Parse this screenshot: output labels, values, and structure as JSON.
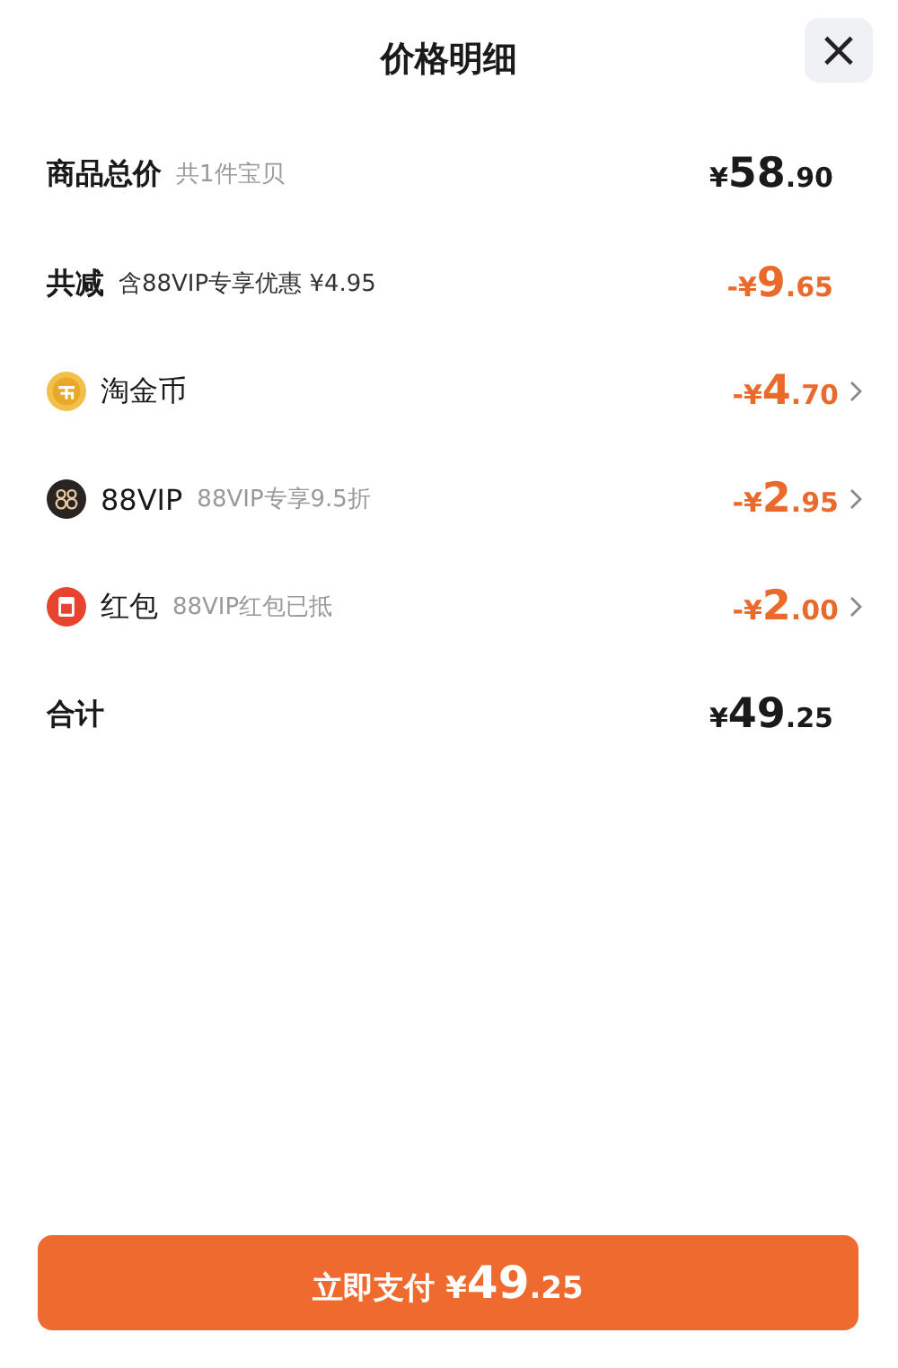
{
  "header": {
    "title": "价格明细",
    "close": "×"
  },
  "rows": [
    {
      "kind": "subtotal",
      "label": "商品总价",
      "note": "共1件宝贝",
      "amount": {
        "prefix": "¥",
        "main": "58",
        "fraction": ".90"
      },
      "link": false
    },
    {
      "kind": "discount_total",
      "label": "共减",
      "note": "含88VIP专享优惠 ¥4.95",
      "amount": {
        "prefix": "-¥",
        "main": "9",
        "fraction": ".65"
      },
      "link": false
    },
    {
      "kind": "coin",
      "label": "淘金币",
      "amount": {
        "prefix": "-¥",
        "main": "4",
        "fraction": ".70"
      },
      "link": true
    },
    {
      "kind": "vip",
      "label": "88VIP",
      "note": "88VIP专享9.5折",
      "amount": {
        "prefix": "-¥",
        "main": "2",
        "fraction": ".95"
      },
      "link": true
    },
    {
      "kind": "packet",
      "label": "红包",
      "note": "88VIP红包已抵",
      "amount": {
        "prefix": "-¥",
        "main": "2",
        "fraction": ".00"
      },
      "link": true
    },
    {
      "kind": "total",
      "label": "合计",
      "amount": {
        "prefix": "¥",
        "main": "49",
        "fraction": ".25"
      },
      "link": false
    }
  ],
  "pay_button": {
    "label": "立即支付",
    "amount": {
      "prefix": "¥",
      "main": "49",
      "fraction": ".25"
    }
  }
}
